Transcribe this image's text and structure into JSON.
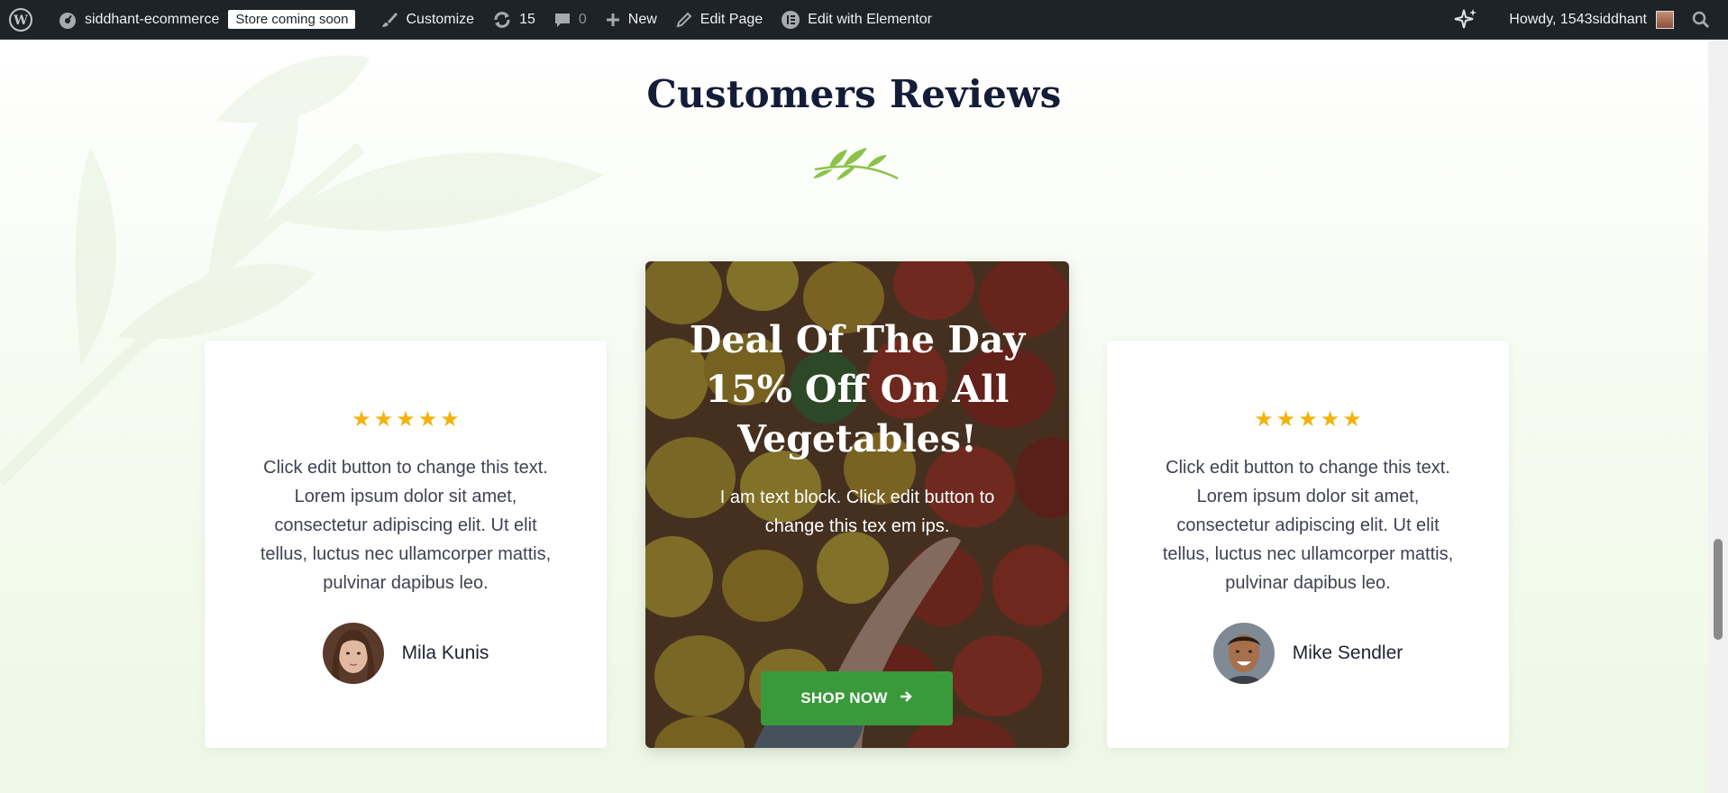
{
  "admin_bar": {
    "site_name": "siddhant-ecommerce",
    "store_badge": "Store coming soon",
    "customize": "Customize",
    "updates_count": "15",
    "comments_count": "0",
    "new": "New",
    "edit_page": "Edit Page",
    "edit_elementor": "Edit with Elementor",
    "howdy": "Howdy, 1543siddhant"
  },
  "section": {
    "heading": "Customers Reviews"
  },
  "reviews": [
    {
      "rating": 5,
      "text": "Click edit button to change this text. Lorem ipsum dolor sit amet, consectetur adipiscing elit. Ut elit tellus, luctus nec ullamcorper mattis, pulvinar dapibus leo.",
      "name": "Mila Kunis"
    },
    {
      "rating": 5,
      "text": "Click edit button to change this text. Lorem ipsum dolor sit amet, consectetur adipiscing elit. Ut elit tellus, luctus nec ullamcorper mattis, pulvinar dapibus leo.",
      "name": "Mike Sendler"
    }
  ],
  "deal": {
    "title": "Deal Of The Day 15% Off On All Vegetables!",
    "text": "I am text block. Click edit button to change this tex em ips.",
    "button": "SHOP NOW"
  },
  "colors": {
    "admin_bar_bg": "#1d2327",
    "heading": "#141d38",
    "star": "#f5b20e",
    "button": "#3a9a3b"
  }
}
